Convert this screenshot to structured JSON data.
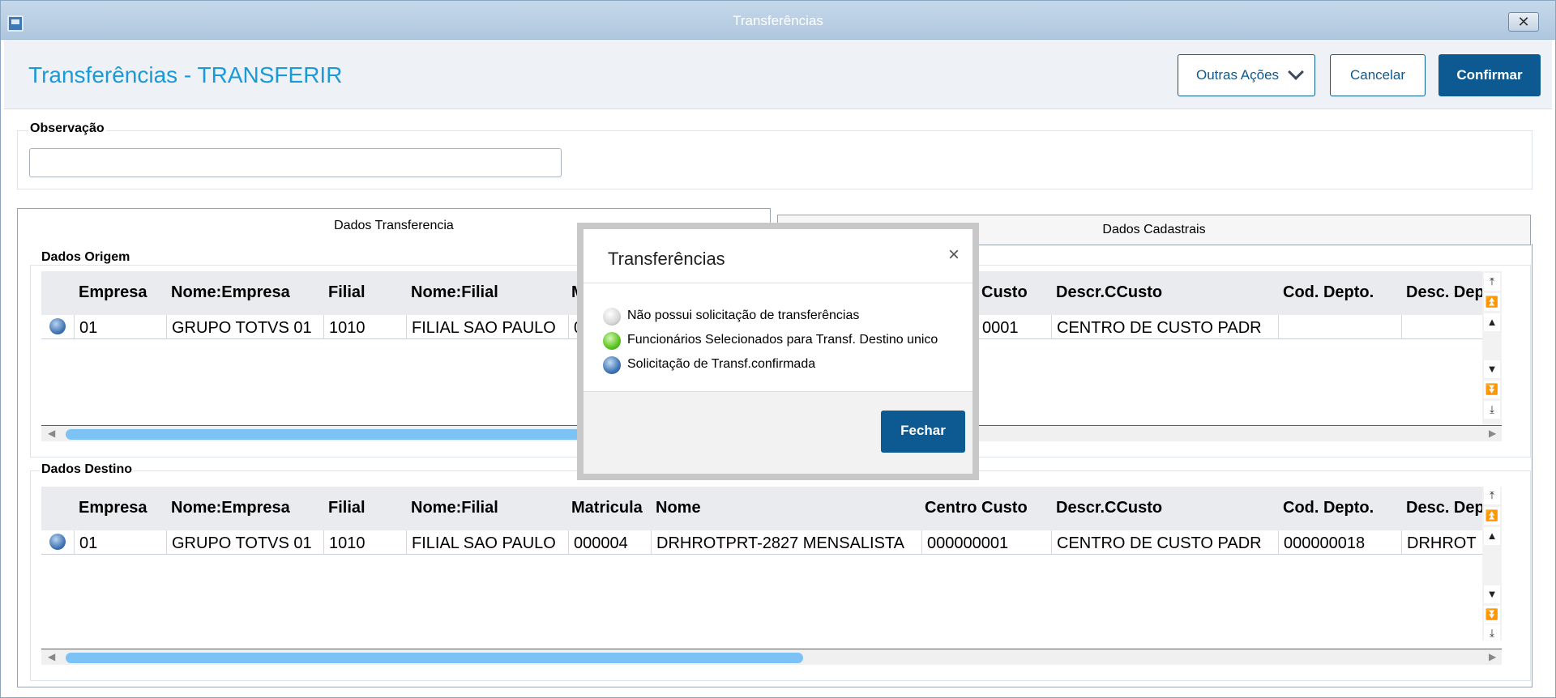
{
  "window": {
    "title": "Transferências",
    "close_glyph": "✕"
  },
  "header": {
    "page_title": "Transferências - TRANSFERIR",
    "more_actions_label": "Outras Ações",
    "cancel_label": "Cancelar",
    "confirm_label": "Confirmar"
  },
  "observacao": {
    "label": "Observação",
    "value": ""
  },
  "tabs": [
    {
      "label": "Dados Transferencia",
      "active": true
    },
    {
      "label": "Dados Cadastrais",
      "active": false
    }
  ],
  "origem": {
    "label": "Dados Origem",
    "columns": [
      "Empresa",
      "Nome:Empresa",
      "Filial",
      "Nome:Filial",
      "M",
      "Custo",
      "Descr.CCusto",
      "Cod. Depto.",
      "Desc. Dep"
    ],
    "rows": [
      {
        "status": "blue",
        "empresa": "01",
        "nome_empresa": "GRUPO TOTVS 01",
        "filial": "1010",
        "nome_filial": "FILIAL SAO PAULO",
        "matricula": "0",
        "centro_custo": "0001",
        "descr_ccusto": "CENTRO DE CUSTO PADR",
        "cod_depto": "",
        "desc_depto": ""
      }
    ]
  },
  "destino": {
    "label": "Dados Destino",
    "columns": [
      "Empresa",
      "Nome:Empresa",
      "Filial",
      "Nome:Filial",
      "Matricula",
      "Nome",
      "Centro Custo",
      "Descr.CCusto",
      "Cod. Depto.",
      "Desc. Dep"
    ],
    "rows": [
      {
        "status": "blue",
        "empresa": "01",
        "nome_empresa": "GRUPO TOTVS 01",
        "filial": "1010",
        "nome_filial": "FILIAL SAO PAULO",
        "matricula": "000004",
        "nome": "DRHROTPRT-2827 MENSALISTA",
        "centro_custo": "000000001",
        "descr_ccusto": "CENTRO DE CUSTO PADR",
        "cod_depto": "000000018",
        "desc_depto": "DRHROT"
      }
    ]
  },
  "scroll_glyphs": {
    "top": "⤒",
    "page_up": "⏫",
    "up": "▲",
    "down": "▼",
    "page_down": "⏬",
    "bottom": "⤓",
    "left": "◀",
    "right": "▶"
  },
  "legend_modal": {
    "title": "Transferências",
    "close_glyph": "×",
    "items": [
      {
        "color": "gray",
        "text": "Não possui solicitação de transferências"
      },
      {
        "color": "green",
        "text": "Funcionários Selecionados para Transf. Destino unico"
      },
      {
        "color": "blue",
        "text": "Solicitação de Transf.confirmada"
      }
    ],
    "close_button_label": "Fechar"
  }
}
